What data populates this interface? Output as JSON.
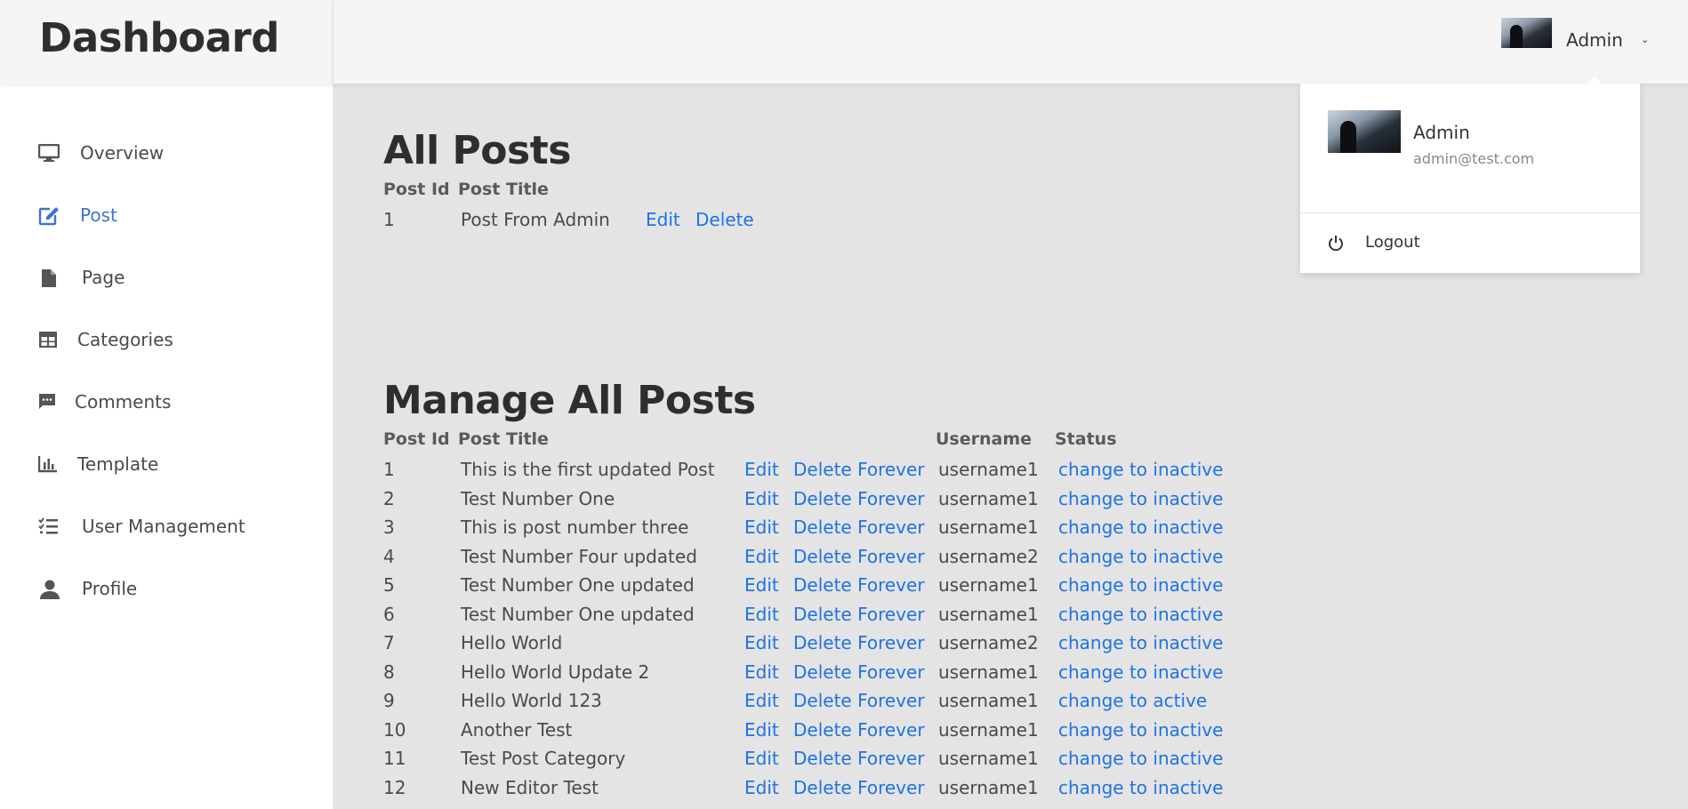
{
  "brand": "Dashboard",
  "sidebar": {
    "items": [
      {
        "label": "Overview",
        "icon": "monitor-icon"
      },
      {
        "label": "Post",
        "icon": "edit-icon",
        "active": true
      },
      {
        "label": "Page",
        "icon": "file-icon"
      },
      {
        "label": "Categories",
        "icon": "table-icon"
      },
      {
        "label": "Comments",
        "icon": "comment-icon"
      },
      {
        "label": "Template",
        "icon": "bar-chart-icon"
      },
      {
        "label": "User Management",
        "icon": "list-check-icon"
      },
      {
        "label": "Profile",
        "icon": "user-icon"
      }
    ]
  },
  "topbar": {
    "user_name": "Admin",
    "chevron": "⌄"
  },
  "dropdown": {
    "name": "Admin",
    "email": "admin@test.com",
    "logout_label": "Logout"
  },
  "all_posts": {
    "title": "All Posts",
    "headers": {
      "id": "Post Id",
      "title": "Post Title"
    },
    "rows": [
      {
        "id": "1",
        "title": "Post From Admin",
        "edit": "Edit",
        "delete": "Delete"
      }
    ]
  },
  "manage_posts": {
    "title": "Manage All Posts",
    "headers": {
      "id": "Post Id",
      "title": "Post Title",
      "username": "Username",
      "status": "Status"
    },
    "rows": [
      {
        "id": "1",
        "title": "This is the first updated Post",
        "edit": "Edit",
        "delete": "Delete Forever",
        "username": "username1",
        "status": "change to inactive"
      },
      {
        "id": "2",
        "title": "Test Number One",
        "edit": "Edit",
        "delete": "Delete Forever",
        "username": "username1",
        "status": "change to inactive"
      },
      {
        "id": "3",
        "title": "This is post number three",
        "edit": "Edit",
        "delete": "Delete Forever",
        "username": "username1",
        "status": "change to inactive"
      },
      {
        "id": "4",
        "title": "Test Number Four updated",
        "edit": "Edit",
        "delete": "Delete Forever",
        "username": "username2",
        "status": "change to inactive"
      },
      {
        "id": "5",
        "title": "Test Number One updated",
        "edit": "Edit",
        "delete": "Delete Forever",
        "username": "username1",
        "status": "change to inactive"
      },
      {
        "id": "6",
        "title": "Test Number One updated",
        "edit": "Edit",
        "delete": "Delete Forever",
        "username": "username1",
        "status": "change to inactive"
      },
      {
        "id": "7",
        "title": "Hello World",
        "edit": "Edit",
        "delete": "Delete Forever",
        "username": "username2",
        "status": "change to inactive"
      },
      {
        "id": "8",
        "title": "Hello World Update 2",
        "edit": "Edit",
        "delete": "Delete Forever",
        "username": "username1",
        "status": "change to inactive"
      },
      {
        "id": "9",
        "title": "Hello World 123",
        "edit": "Edit",
        "delete": "Delete Forever",
        "username": "username1",
        "status": "change to active"
      },
      {
        "id": "10",
        "title": "Another Test",
        "edit": "Edit",
        "delete": "Delete Forever",
        "username": "username1",
        "status": "change to inactive"
      },
      {
        "id": "11",
        "title": "Test Post Category",
        "edit": "Edit",
        "delete": "Delete Forever",
        "username": "username1",
        "status": "change to inactive"
      },
      {
        "id": "12",
        "title": "New Editor Test",
        "edit": "Edit",
        "delete": "Delete Forever",
        "username": "username1",
        "status": "change to inactive"
      }
    ]
  },
  "colors": {
    "accent": "#3b74d4",
    "link": "#1e73e8",
    "content_bg": "#e4e4e4",
    "header_bg": "#f5f5f5"
  }
}
